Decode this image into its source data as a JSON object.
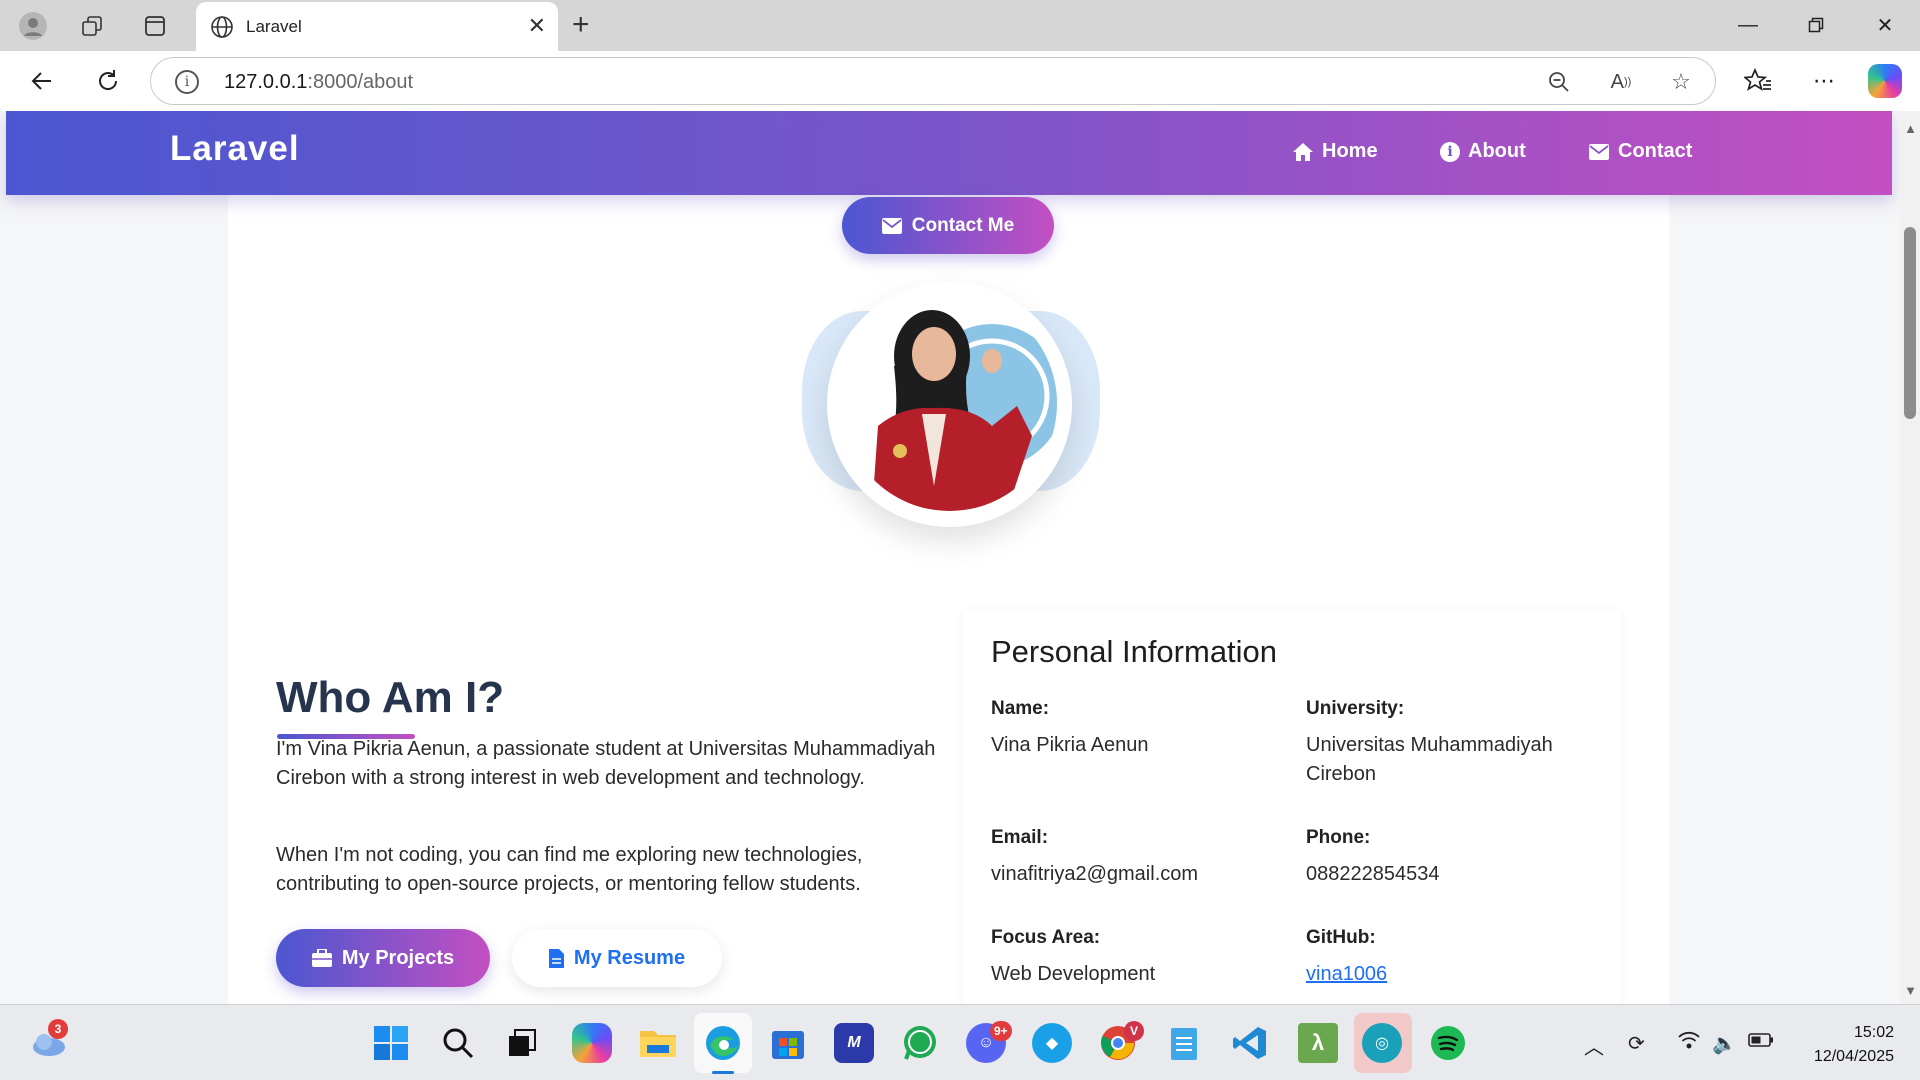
{
  "browser": {
    "tab_title": "Laravel",
    "url_host": "127.0.0.1",
    "url_path": ":8000/about"
  },
  "site": {
    "brand": "Laravel",
    "nav": [
      {
        "label": "Home",
        "icon": "home-icon"
      },
      {
        "label": "About",
        "icon": "info-icon"
      },
      {
        "label": "Contact",
        "icon": "envelope-icon"
      }
    ],
    "contact_button": "Contact Me"
  },
  "about": {
    "title": "Who Am I?",
    "para1": "I'm Vina Pikria Aenun, a passionate student at Universitas Muhammadiyah Cirebon with a strong interest in web development and technology.",
    "para2": "When I'm not coding, you can find me exploring new technologies, contributing to open-source projects, or mentoring fellow students.",
    "projects_button": "My Projects",
    "resume_button": "My Resume"
  },
  "personal_info": {
    "title": "Personal Information",
    "name_label": "Name:",
    "name": "Vina Pikria Aenun",
    "university_label": "University:",
    "university": "Universitas Muhammadiyah Cirebon",
    "email_label": "Email:",
    "email": "vinafitriya2@gmail.com",
    "phone_label": "Phone:",
    "phone": "088222854534",
    "focus_label": "Focus Area:",
    "focus": "Web Development",
    "github_label": "GitHub:",
    "github": "vina1006"
  },
  "taskbar": {
    "weather_badge": "3",
    "discord_badge": "9+",
    "chrome_badge": "V",
    "time": "15:02",
    "date": "12/04/2025"
  },
  "colors": {
    "gradient_start": "#4b57d1",
    "gradient_end": "#c34fc2",
    "link": "#1f6ff2",
    "heading": "#27344d"
  }
}
